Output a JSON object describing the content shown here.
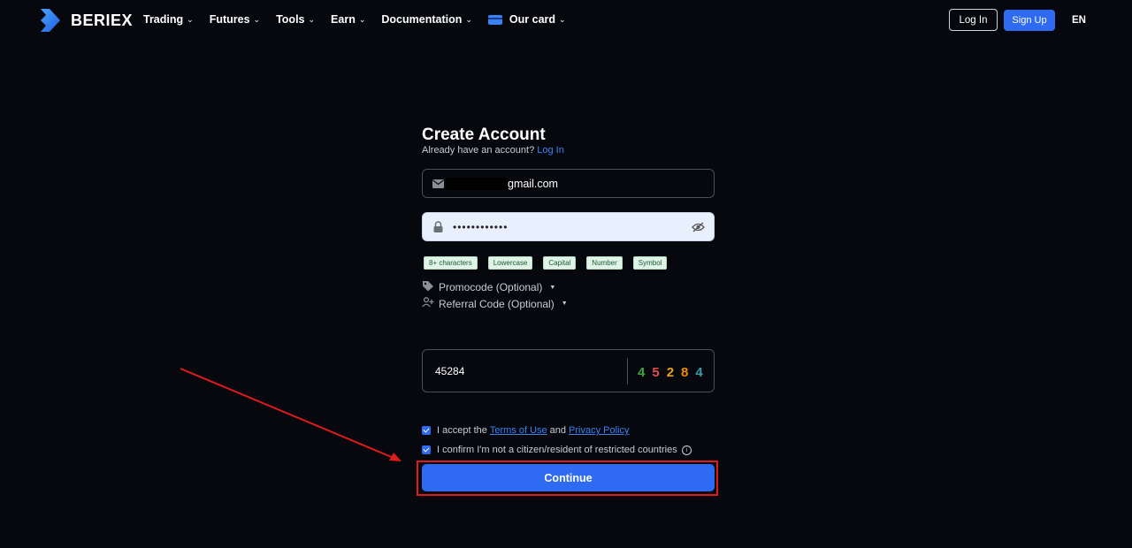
{
  "header": {
    "brand": "BERIEX",
    "nav": [
      {
        "label": "Trading"
      },
      {
        "label": "Futures"
      },
      {
        "label": "Tools"
      },
      {
        "label": "Earn"
      },
      {
        "label": "Documentation"
      },
      {
        "label": "Our card"
      }
    ],
    "login_label": "Log In",
    "signup_label": "Sign Up",
    "language": "EN"
  },
  "form": {
    "title": "Create Account",
    "subtitle_prefix": "Already have an account?",
    "subtitle_link": "Log In",
    "email_value": "gmail.com",
    "password_value": "••••••••••••",
    "requirements": [
      "8+ characters",
      "Lowercase",
      "Capital",
      "Number",
      "Symbol"
    ],
    "promocode_label": "Promocode (Optional)",
    "referral_label": "Referral Code (Optional)",
    "captcha_value": "45284",
    "captcha_digits": [
      {
        "d": "4",
        "color": "#3fa33f"
      },
      {
        "d": "5",
        "color": "#e05050"
      },
      {
        "d": "2",
        "color": "#f0a020"
      },
      {
        "d": "8",
        "color": "#f08c00"
      },
      {
        "d": "4",
        "color": "#3a9aa8"
      }
    ],
    "terms_prefix": "I accept the",
    "terms_link": "Terms of Use",
    "terms_and": "and",
    "privacy_link": "Privacy Policy",
    "citizen_text": "I confirm I'm not a citizen/resident of restricted countries",
    "continue_label": "Continue"
  },
  "colors": {
    "accent": "#2f6bf2",
    "highlight": "#e01b1b",
    "background": "#06080d"
  }
}
